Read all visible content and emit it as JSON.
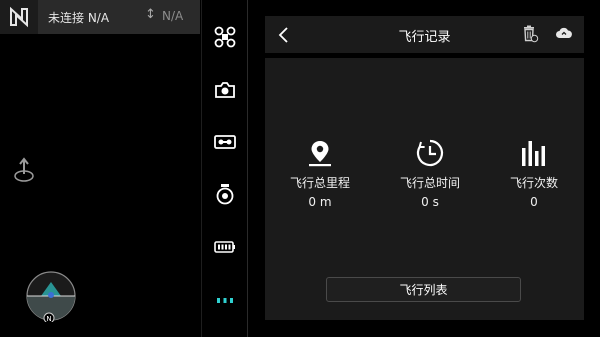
{
  "status": {
    "connection_text": "未连接 N/A",
    "altitude_text": "N/A"
  },
  "compass": {
    "north_label": "N"
  },
  "toolbar": {
    "items": [
      "drone-icon",
      "camera-icon",
      "recorder-icon",
      "gimbal-icon",
      "battery-icon",
      "more-icon"
    ],
    "active_color": "#2fd1d1"
  },
  "panel": {
    "title": "飞行记录",
    "stats": [
      {
        "icon": "location-pin-icon",
        "label": "飞行总里程",
        "value": "0 m"
      },
      {
        "icon": "timer-icon",
        "label": "飞行总时间",
        "value": "0 s"
      },
      {
        "icon": "bar-chart-icon",
        "label": "飞行次数",
        "value": "0"
      }
    ],
    "flight_list_label": "飞行列表"
  }
}
